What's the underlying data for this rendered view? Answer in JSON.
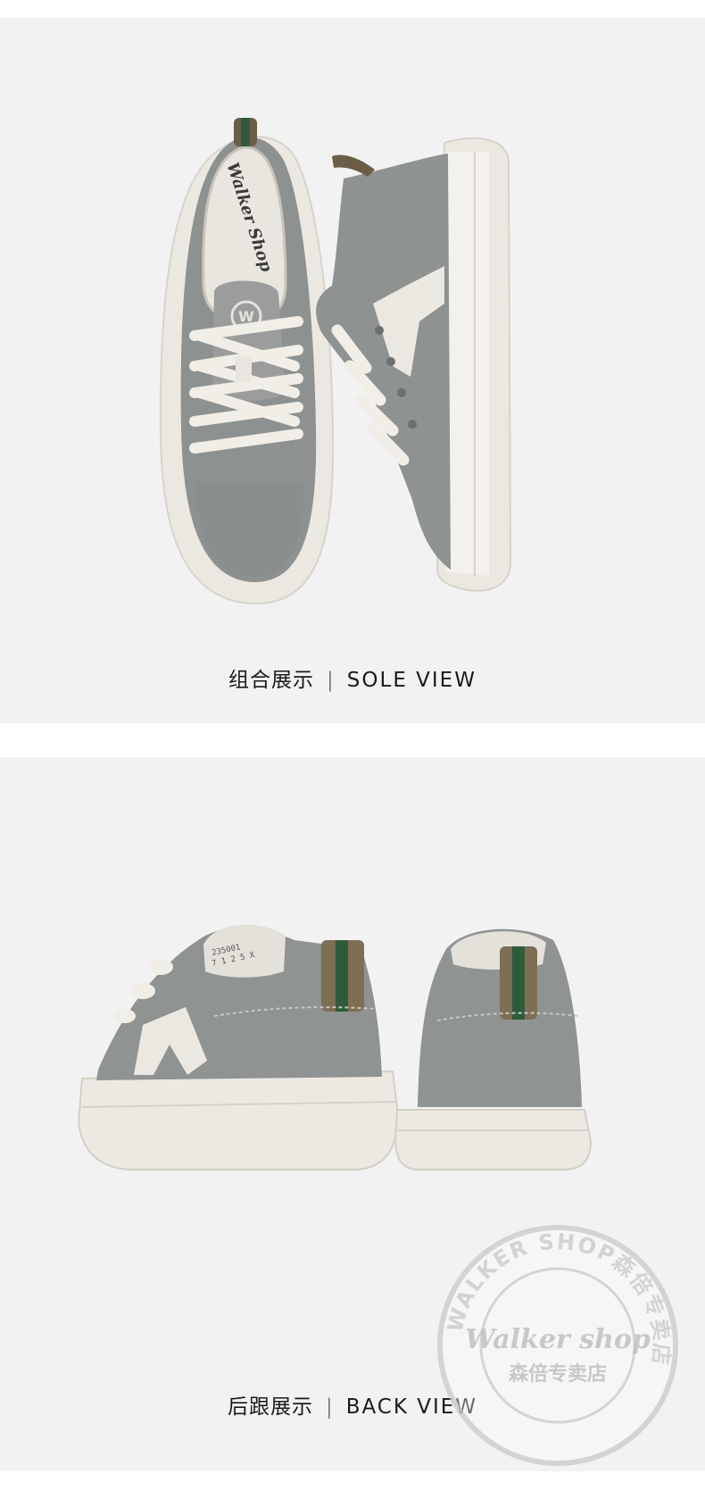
{
  "sections": [
    {
      "caption_cn": "组合展示",
      "caption_divider": "|",
      "caption_en": "SOLE  VIEW",
      "insole_brand": "Walker Shop"
    },
    {
      "caption_cn": "后跟展示",
      "caption_divider": "|",
      "caption_en": "BACK  VIEW",
      "label_line1": "235001",
      "label_line2": "7 1 2 5 X"
    }
  ],
  "watermark": {
    "ring_text": "WALKER SHOP森倍专卖店",
    "brand": "Walker shop",
    "subtitle": "森倍专卖店"
  },
  "colors": {
    "background": "#f2f2f2",
    "upper_gray": "#8f9391",
    "sole_white": "#ece9e3",
    "heel_green": "#2f5a3c",
    "heel_olive": "#7d6e54"
  }
}
